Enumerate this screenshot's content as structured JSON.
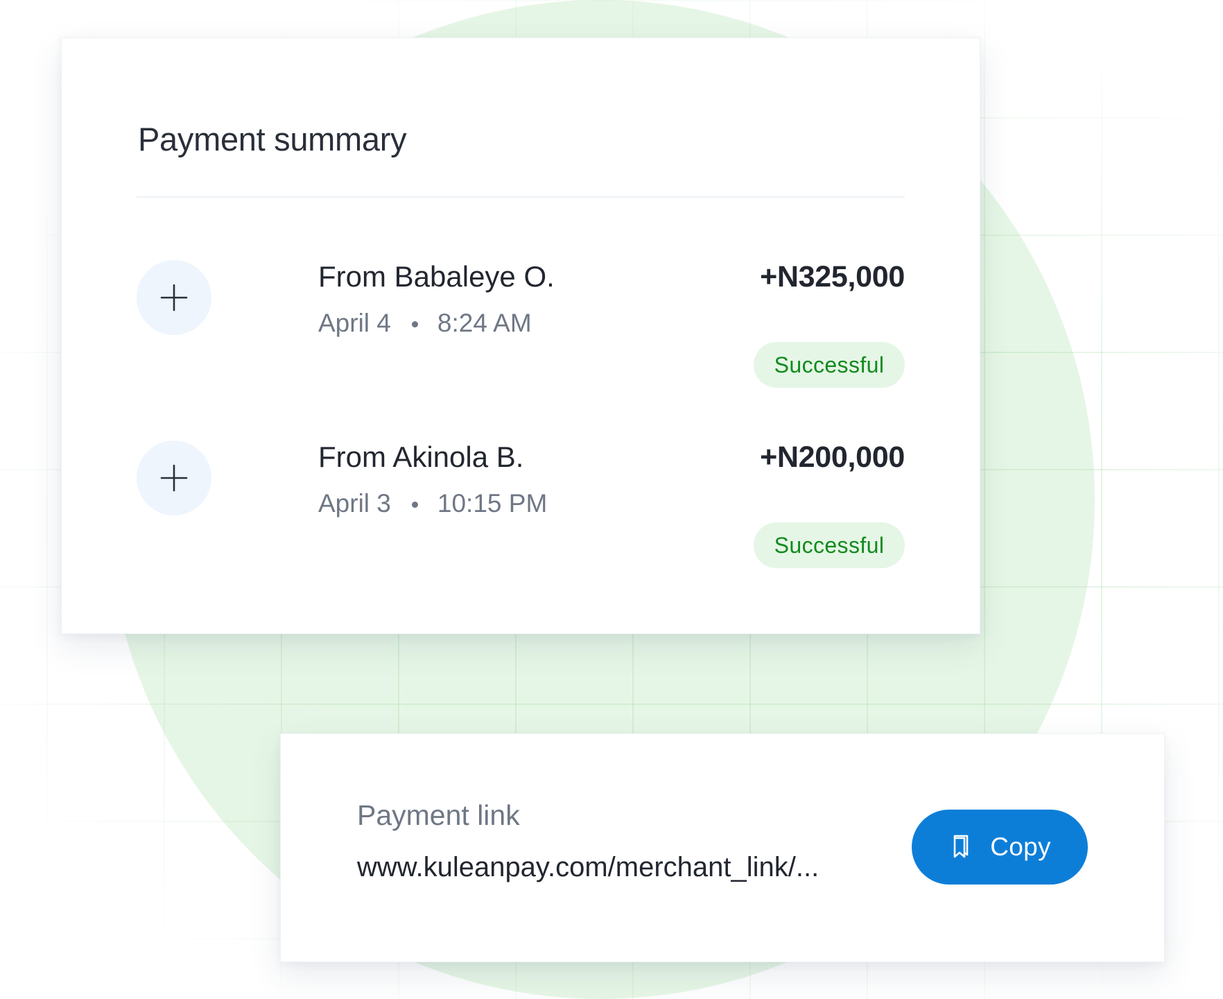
{
  "summary": {
    "title": "Payment summary",
    "transactions": [
      {
        "name": "From Babaleye O.",
        "date": "April 4",
        "time": "8:24 AM",
        "amount": "+N325,000",
        "status": "Successful",
        "icon": "plus-icon"
      },
      {
        "name": "From Akinola B.",
        "date": "April 3",
        "time": "10:15 PM",
        "amount": "+N200,000",
        "status": "Successful",
        "icon": "plus-icon"
      }
    ]
  },
  "payment_link": {
    "label": "Payment link",
    "url": "www.kuleanpay.com/merchant_link/...",
    "copy_label": "Copy",
    "copy_icon": "copy-icon"
  },
  "colors": {
    "accent": "#0d7ed8",
    "success_text": "#128a1e",
    "success_bg": "#e5f6e6",
    "background_circle": "#e6f6e6",
    "icon_circle": "#eef5fd"
  }
}
